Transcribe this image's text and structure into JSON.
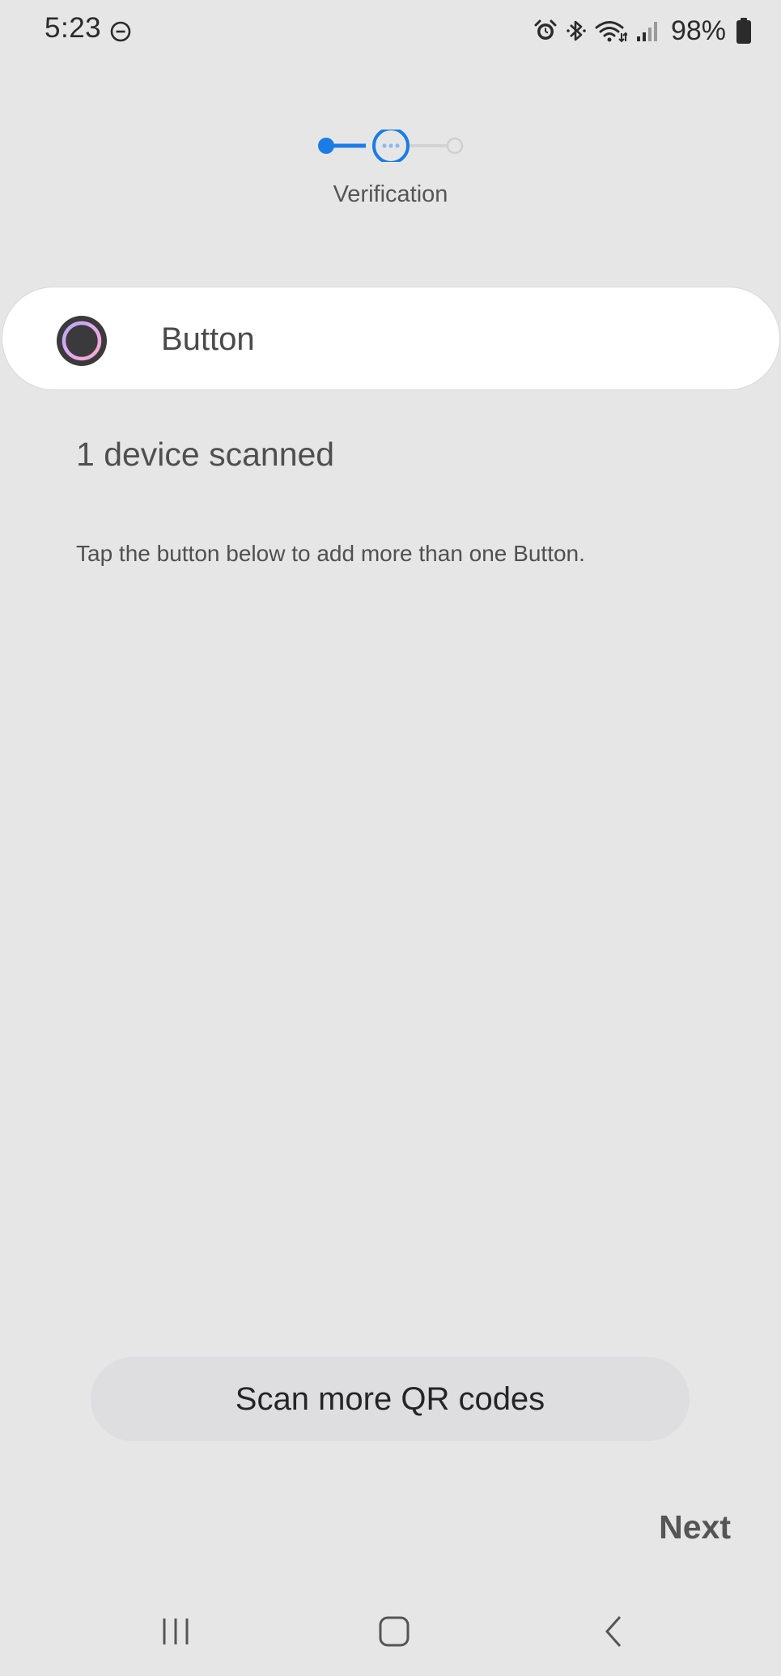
{
  "status_bar": {
    "time": "5:23",
    "battery": "98%",
    "icons": [
      "do-not-disturb-icon",
      "alarm-icon",
      "bluetooth-icon",
      "wifi-icon",
      "signal-icon",
      "battery-icon"
    ]
  },
  "stepper": {
    "current_label": "Verification",
    "steps_total": 3,
    "current_step": 2
  },
  "device_card": {
    "name": "Button"
  },
  "scan_status": {
    "count_text": "1 device scanned",
    "helper_text": "Tap the button below to add more than one Button."
  },
  "actions": {
    "scan_more_label": "Scan more QR codes",
    "next_label": "Next"
  },
  "navigation": {
    "icons": [
      "recent-apps-icon",
      "home-icon",
      "back-icon"
    ]
  },
  "colors": {
    "accent": "#1a7de6",
    "background": "#e6e6e7",
    "card": "#ffffff"
  }
}
